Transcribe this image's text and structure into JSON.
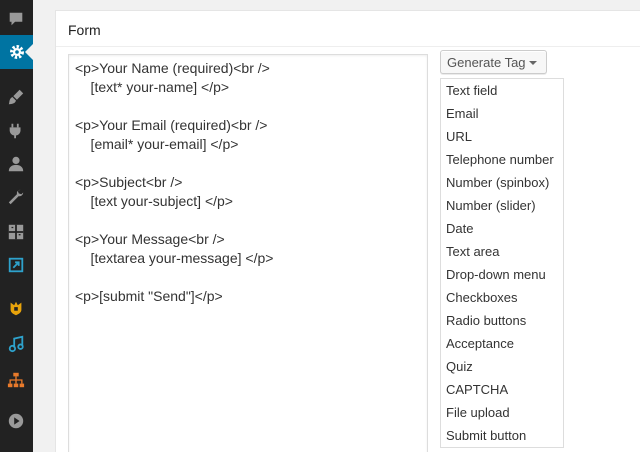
{
  "sidebar": {
    "icons": [
      {
        "name": "comments-icon",
        "active": false
      },
      {
        "name": "settings-gear-icon",
        "active": true
      },
      {
        "name": "appearance-brush-icon",
        "active": false
      },
      {
        "name": "plugins-icon",
        "active": false
      },
      {
        "name": "users-icon",
        "active": false
      },
      {
        "name": "tools-wrench-icon",
        "active": false
      },
      {
        "name": "grid-icon",
        "active": false
      },
      {
        "name": "plugin-arrow-icon",
        "active": false
      },
      {
        "name": "plugin-lock-icon",
        "active": false
      },
      {
        "name": "plugin-music-icon",
        "active": false
      },
      {
        "name": "sitemap-icon",
        "active": false
      },
      {
        "name": "play-icon",
        "active": false
      }
    ],
    "colors": {
      "bg": "#222222",
      "icon": "#999999",
      "active_bg": "#0074a2"
    }
  },
  "panel": {
    "title": "Form",
    "editor_lines": [
      "<p>Your Name (required)<br />",
      "    [text* your-name] </p>",
      "",
      "<p>Your Email (required)<br />",
      "    [email* your-email] </p>",
      "",
      "<p>Subject<br />",
      "    [text your-subject] </p>",
      "",
      "<p>Your Message<br />",
      "    [textarea your-message] </p>",
      "",
      "<p>[submit \"Send\"]</p>"
    ]
  },
  "generate_tag": {
    "label": "Generate Tag",
    "items": [
      "Text field",
      "Email",
      "URL",
      "Telephone number",
      "Number (spinbox)",
      "Number (slider)",
      "Date",
      "Text area",
      "Drop-down menu",
      "Checkboxes",
      "Radio buttons",
      "Acceptance",
      "Quiz",
      "CAPTCHA",
      "File upload",
      "Submit button"
    ]
  }
}
